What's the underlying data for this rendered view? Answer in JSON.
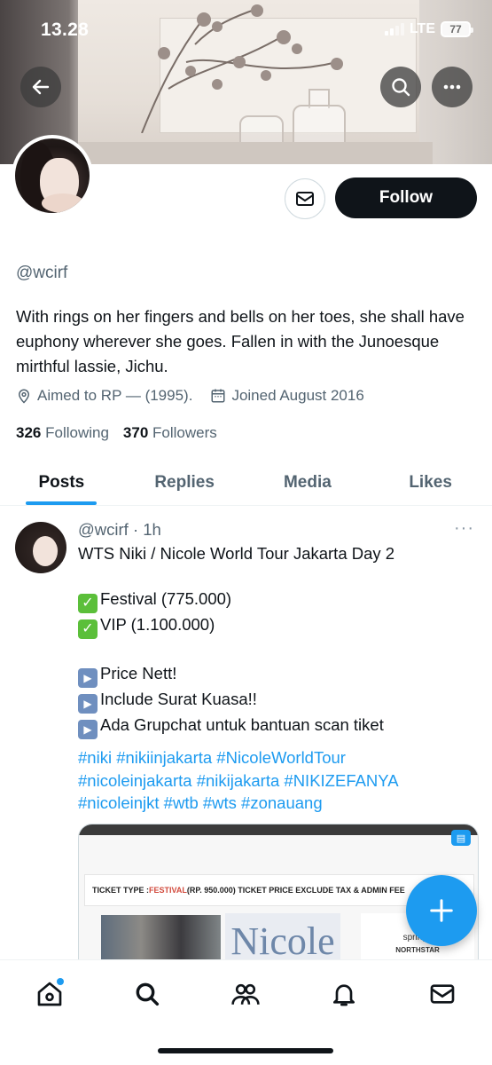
{
  "status_bar": {
    "time": "13.28",
    "network": "LTE",
    "battery": "77"
  },
  "profile": {
    "handle": "@wcirf",
    "bio": "With rings on her fingers and bells on her toes, she shall have euphony wherever she goes. Fallen in with the Junoesque mirthful lassie, Jichu.",
    "location": "Aimed to RP — (1995).",
    "joined": "Joined August 2016",
    "following_count": "326",
    "following_label": "Following",
    "followers_count": "370",
    "followers_label": "Followers",
    "follow_label": "Follow"
  },
  "tabs": [
    {
      "label": "Posts",
      "active": true
    },
    {
      "label": "Replies",
      "active": false
    },
    {
      "label": "Media",
      "active": false
    },
    {
      "label": "Likes",
      "active": false
    }
  ],
  "tweet": {
    "header": "@wcirf · 1h",
    "more": "···",
    "lines": [
      "WTS Niki / Nicole World Tour Jakarta Day 2",
      "",
      "Festival (775.000)",
      "VIP  (1.100.000)",
      "",
      "Price Nett!",
      "Include Surat Kuasa!!",
      "Ada Grupchat untuk bantuan scan tiket"
    ],
    "hashtags": [
      "#niki #nikiinjakarta #NicoleWorldTour",
      "#nicoleinjakarta #nikijakarta #NIKIZEFANYA",
      "#nicoleinjkt #wtb #wts #zonauang"
    ],
    "media": {
      "ticket_prefix": "TICKET TYPE : ",
      "ticket_type": "FESTIVAL",
      "ticket_suffix": " (RP. 950.000) TICKET PRICE EXCLUDE TAX & ADMIN FEE",
      "poster_word": "Nicole",
      "sponsor_1": "springb",
      "sponsor_2": "NORTHSTAR"
    }
  },
  "icons": {
    "back": "back-arrow-icon",
    "search": "search-icon",
    "more": "more-icon",
    "mail": "mail-icon",
    "location": "location-pin-icon",
    "calendar": "calendar-icon",
    "compose": "plus-icon",
    "nav": [
      "home-icon",
      "search-icon",
      "communities-icon",
      "notifications-icon",
      "messages-icon"
    ]
  },
  "colors": {
    "accent": "#1d9bf0",
    "follow_button": "#0f1419"
  }
}
